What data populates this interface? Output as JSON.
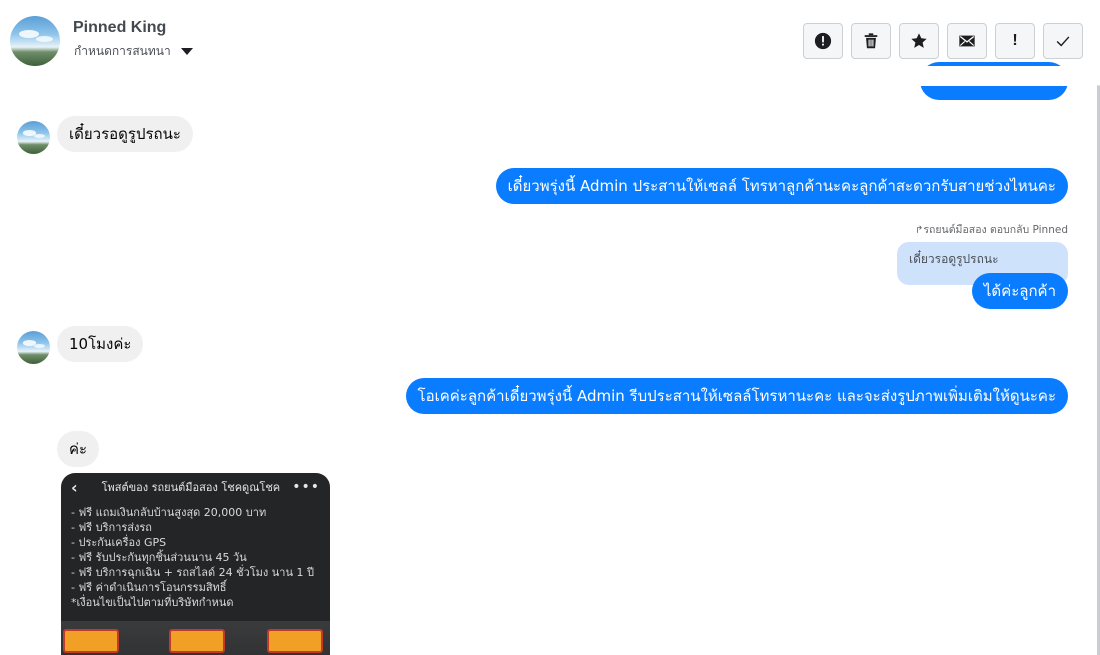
{
  "header": {
    "contact_name": "Pinned King",
    "subtitle": "กำหนดการสนทนา",
    "icons": {
      "avatar": "sky-landscape-avatar",
      "caret": "caret-down-icon"
    },
    "toolbar": [
      {
        "name": "report-button",
        "icon": "alert-circle-icon"
      },
      {
        "name": "delete-button",
        "icon": "trash-icon"
      },
      {
        "name": "star-button",
        "icon": "star-icon"
      },
      {
        "name": "mark-unread-button",
        "icon": "envelope-icon"
      },
      {
        "name": "important-button",
        "icon": "exclamation-icon",
        "glyph": "!"
      },
      {
        "name": "done-button",
        "icon": "checkmark-icon"
      }
    ]
  },
  "messages": {
    "m1_in": "เดี๋ยวรอดูรูปรถนะ",
    "m2_out": "เดี๋ยวพรุ่งนี้ Admin ประสานให้เซลล์ โทรหาลูกค้านะคะลูกค้าสะดวกรับสายช่วงไหนคะ",
    "reply_meta": "รถยนต์มือสอง ตอบกลับ Pinned",
    "reply_quote": "เดี๋ยวรอดูรูปรถนะ",
    "m3_out": "ได้ค่ะลูกค้า",
    "m4_in": "10โมงค่ะ",
    "m5_out": "โอเคค่ะลูกค้าเดี๋ยวพรุ่งนี้ Admin รีบประสานให้เซลล์โทรหานะคะ และจะส่งรูปภาพเพิ่มเติมให้ดูนะคะ",
    "m6_in": "ค่ะ"
  },
  "attachment": {
    "header_title": "โพสต์ของ รถยนต์มือสอง โชคดูณโชค",
    "lines": [
      "- ฟรี แถมเงินกลับบ้านสูงสุด 20,000 บาท",
      "- ฟรี บริการส่งรถ",
      "- ประกันเครื่อง GPS",
      "- ฟรี รับประกันทุกชิ้นส่วนนาน 45 วัน",
      "- ฟรี บริการฉุกเฉิน + รถสไลด์ 24 ชั่วโมง นาน 1 ปี",
      "- ฟรี ค่าดำเนินการโอนกรรมสิทธิ์",
      "*เงื่อนไขเป็นไปตามที่บริษัทกำหนด"
    ]
  },
  "colors": {
    "outgoing_bubble": "#0a7cff",
    "incoming_bubble": "#f0f0f0",
    "reply_quote_bg": "#cfe2fc"
  }
}
